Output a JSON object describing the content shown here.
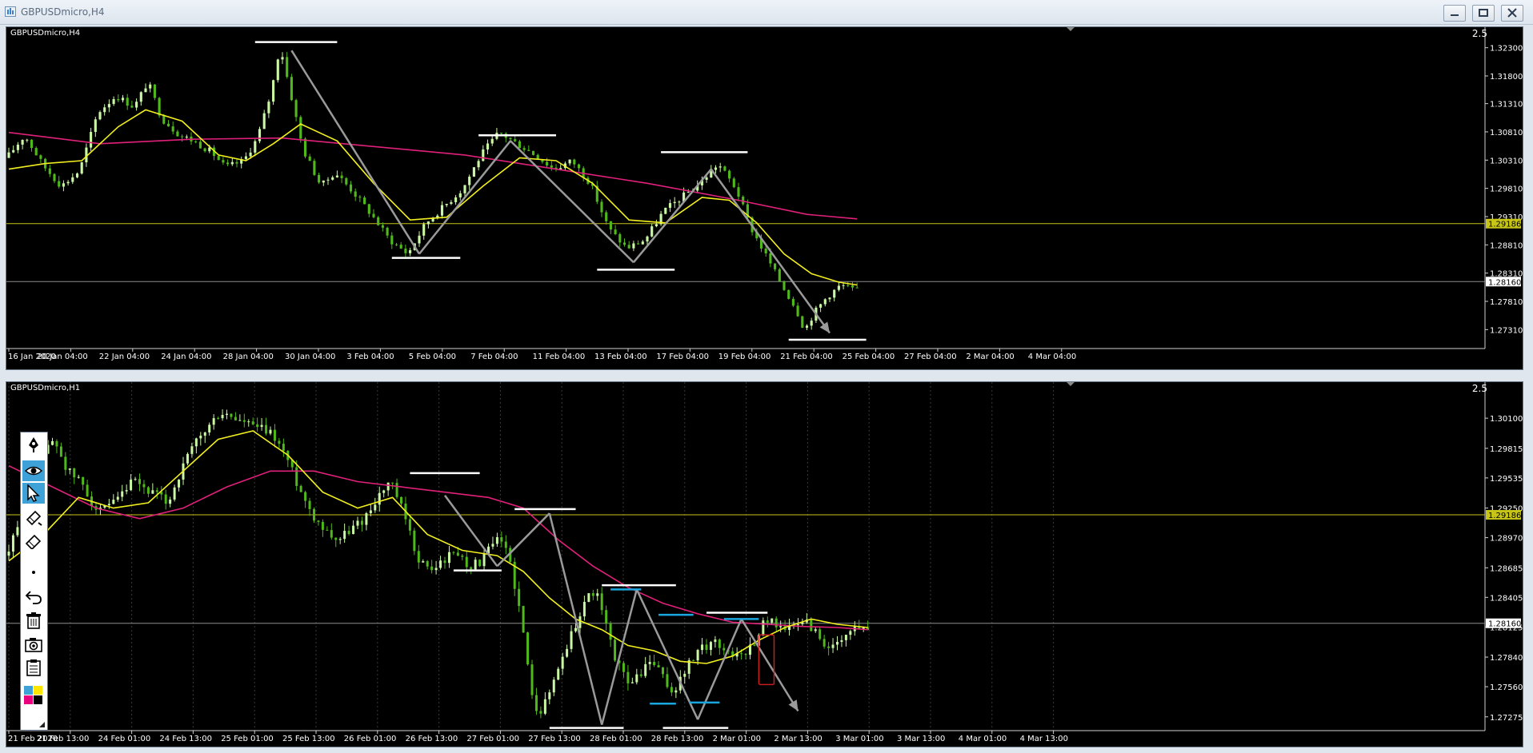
{
  "window": {
    "title": "GBPUSDmicro,H4"
  },
  "window_buttons": [
    "minimize",
    "restore",
    "close"
  ],
  "colors": {
    "background": "#000000",
    "bull_candle": "#caf7a4",
    "bear_candle": "#4fb81a",
    "ma_fast": "#f2ef1e",
    "ma_slow": "#e0207a",
    "horizontal_line": "#c7c418",
    "price_line": "#8e8e8e",
    "swing_line": "#9a9a9a",
    "level_white": "#ffffff",
    "level_cyan": "#19a7e0",
    "highlight_box": "#c81e1e"
  },
  "panes": [
    {
      "label": "GBPUSDmicro,H4",
      "scale_number": "2.5",
      "price_ticks": [
        "1.32300",
        "1.31800",
        "1.31310",
        "1.30810",
        "1.30310",
        "1.29810",
        "1.29310",
        "1.28810",
        "1.28310",
        "1.27810",
        "1.27310"
      ],
      "date_ticks": [
        "16 Jan 2020",
        "20 Jan 04:00",
        "22 Jan 04:00",
        "24 Jan 04:00",
        "28 Jan 04:00",
        "30 Jan 04:00",
        "3 Feb 04:00",
        "5 Feb 04:00",
        "7 Feb 04:00",
        "11 Feb 04:00",
        "13 Feb 04:00",
        "17 Feb 04:00",
        "19 Feb 04:00",
        "21 Feb 04:00",
        "25 Feb 04:00",
        "27 Feb 04:00",
        "2 Mar 04:00",
        "4 Mar 04:00"
      ],
      "hline_label": "1.29186",
      "price_label": "1.28160"
    },
    {
      "label": "GBPUSDmicro,H1",
      "scale_number": "2.5",
      "price_ticks": [
        "1.30100",
        "1.29815",
        "1.29535",
        "1.29250",
        "1.28970",
        "1.28685",
        "1.28405",
        "1.28125",
        "1.27840",
        "1.27560",
        "1.27275"
      ],
      "date_ticks": [
        "21 Feb 2020",
        "21 Feb 13:00",
        "24 Feb 01:00",
        "24 Feb 13:00",
        "25 Feb 01:00",
        "25 Feb 13:00",
        "26 Feb 01:00",
        "26 Feb 13:00",
        "27 Feb 01:00",
        "27 Feb 13:00",
        "28 Feb 01:00",
        "28 Feb 13:00",
        "2 Mar 01:00",
        "2 Mar 13:00",
        "3 Mar 01:00",
        "3 Mar 13:00",
        "4 Mar 01:00",
        "4 Mar 13:00"
      ],
      "hline_label": "1.29186",
      "price_label": "1.28160"
    }
  ],
  "drawing_toolbar": {
    "tools": [
      "pen-icon",
      "eye-icon",
      "cursor-icon",
      "pencil-icon",
      "eraser-icon",
      "dot-icon",
      "undo-icon",
      "trash-icon",
      "camera-icon",
      "clipboard-icon"
    ],
    "palette": [
      "#3ea2d8",
      "#ffe600",
      "#e8007e",
      "#000000"
    ]
  },
  "chart_data": [
    {
      "type": "candlestick",
      "title": "GBPUSDmicro,H4",
      "ylim": [
        1.2706,
        1.3255
      ],
      "horizontal_levels": [
        1.29186,
        1.2816
      ],
      "price_path": [
        [
          0,
          1.3035
        ],
        [
          4,
          1.3075
        ],
        [
          8,
          1.3022
        ],
        [
          12,
          1.2985
        ],
        [
          16,
          1.3012
        ],
        [
          20,
          1.3115
        ],
        [
          24,
          1.3145
        ],
        [
          28,
          1.3125
        ],
        [
          31,
          1.317
        ],
        [
          34,
          1.3105
        ],
        [
          38,
          1.3075
        ],
        [
          41,
          1.3065
        ],
        [
          45,
          1.3045
        ],
        [
          48,
          1.3018
        ],
        [
          52,
          1.303
        ],
        [
          55,
          1.307
        ],
        [
          58,
          1.315
        ],
        [
          60,
          1.3235
        ],
        [
          62,
          1.316
        ],
        [
          65,
          1.305
        ],
        [
          69,
          1.2985
        ],
        [
          72,
          1.301
        ],
        [
          76,
          1.2975
        ],
        [
          80,
          1.2935
        ],
        [
          84,
          1.289
        ],
        [
          88,
          1.2865
        ],
        [
          92,
          1.292
        ],
        [
          96,
          1.295
        ],
        [
          100,
          1.298
        ],
        [
          104,
          1.304
        ],
        [
          108,
          1.308
        ],
        [
          112,
          1.306
        ],
        [
          116,
          1.304
        ],
        [
          120,
          1.3015
        ],
        [
          124,
          1.303
        ],
        [
          128,
          1.299
        ],
        [
          132,
          1.291
        ],
        [
          136,
          1.2875
        ],
        [
          140,
          1.289
        ],
        [
          144,
          1.294
        ],
        [
          148,
          1.2965
        ],
        [
          152,
          1.299
        ],
        [
          156,
          1.3025
        ],
        [
          160,
          1.298
        ],
        [
          163,
          1.2915
        ],
        [
          166,
          1.287
        ],
        [
          170,
          1.281
        ],
        [
          173,
          1.277
        ],
        [
          175,
          1.273
        ],
        [
          177,
          1.276
        ],
        [
          180,
          1.279
        ],
        [
          183,
          1.281
        ],
        [
          186,
          1.28
        ]
      ],
      "ma_fast": [
        [
          0,
          1.3015
        ],
        [
          8,
          1.3025
        ],
        [
          16,
          1.303
        ],
        [
          24,
          1.309
        ],
        [
          30,
          1.312
        ],
        [
          38,
          1.31
        ],
        [
          46,
          1.304
        ],
        [
          52,
          1.303
        ],
        [
          58,
          1.306
        ],
        [
          64,
          1.3095
        ],
        [
          72,
          1.3065
        ],
        [
          80,
          1.299
        ],
        [
          88,
          1.2925
        ],
        [
          96,
          1.293
        ],
        [
          104,
          1.2985
        ],
        [
          112,
          1.3035
        ],
        [
          120,
          1.303
        ],
        [
          128,
          1.299
        ],
        [
          136,
          1.2925
        ],
        [
          144,
          1.292
        ],
        [
          152,
          1.2965
        ],
        [
          158,
          1.296
        ],
        [
          164,
          1.292
        ],
        [
          170,
          1.2865
        ],
        [
          176,
          1.283
        ],
        [
          182,
          1.2815
        ],
        [
          186,
          1.281
        ]
      ],
      "ma_slow": [
        [
          0,
          1.308
        ],
        [
          20,
          1.306
        ],
        [
          40,
          1.3068
        ],
        [
          60,
          1.307
        ],
        [
          80,
          1.3055
        ],
        [
          100,
          1.304
        ],
        [
          120,
          1.3015
        ],
        [
          140,
          1.299
        ],
        [
          160,
          1.296
        ],
        [
          175,
          1.2935
        ],
        [
          186,
          1.2927
        ]
      ],
      "swing_lines": [
        [
          [
            62,
            1.3225
          ],
          [
            90,
            1.2865
          ]
        ],
        [
          [
            90,
            1.2865
          ],
          [
            110,
            1.3065
          ]
        ],
        [
          [
            110,
            1.3065
          ],
          [
            137,
            1.285
          ]
        ],
        [
          [
            137,
            1.285
          ],
          [
            154,
            1.3015
          ]
        ],
        [
          [
            154,
            1.3015
          ],
          [
            180,
            1.2725
          ]
        ]
      ],
      "levels": [
        {
          "y": 1.324,
          "x1": 54,
          "x2": 72
        },
        {
          "y": 1.3075,
          "x1": 103,
          "x2": 120
        },
        {
          "y": 1.2858,
          "x1": 84,
          "x2": 99
        },
        {
          "y": 1.3045,
          "x1": 143,
          "x2": 162
        },
        {
          "y": 1.2837,
          "x1": 129,
          "x2": 146
        },
        {
          "y": 1.2713,
          "x1": 171,
          "x2": 188
        }
      ]
    },
    {
      "type": "candlestick",
      "title": "GBPUSDmicro,H1",
      "ylim": [
        1.2719,
        1.3026
      ],
      "horizontal_levels": [
        1.29186,
        1.2816
      ],
      "price_path": [
        [
          0,
          1.288
        ],
        [
          4,
          1.292
        ],
        [
          8,
          1.2975
        ],
        [
          11,
          1.299
        ],
        [
          14,
          1.296
        ],
        [
          17,
          1.295
        ],
        [
          21,
          1.292
        ],
        [
          25,
          1.293
        ],
        [
          29,
          1.295
        ],
        [
          33,
          1.294
        ],
        [
          37,
          1.293
        ],
        [
          40,
          1.296
        ],
        [
          43,
          1.2985
        ],
        [
          46,
          1.3
        ],
        [
          49,
          1.3015
        ],
        [
          52,
          1.301
        ],
        [
          55,
          1.3005
        ],
        [
          58,
          1.3
        ],
        [
          61,
          1.2995
        ],
        [
          64,
          1.2975
        ],
        [
          67,
          1.2945
        ],
        [
          70,
          1.292
        ],
        [
          73,
          1.2905
        ],
        [
          76,
          1.2895
        ],
        [
          79,
          1.2905
        ],
        [
          82,
          1.2915
        ],
        [
          85,
          1.2935
        ],
        [
          88,
          1.295
        ],
        [
          91,
          1.292
        ],
        [
          94,
          1.288
        ],
        [
          97,
          1.2865
        ],
        [
          100,
          1.2875
        ],
        [
          103,
          1.2885
        ],
        [
          106,
          1.287
        ],
        [
          109,
          1.2875
        ],
        [
          112,
          1.2895
        ],
        [
          115,
          1.2885
        ],
        [
          118,
          1.282
        ],
        [
          120,
          1.276
        ],
        [
          122,
          1.273
        ],
        [
          124,
          1.2745
        ],
        [
          127,
          1.278
        ],
        [
          130,
          1.281
        ],
        [
          133,
          1.284
        ],
        [
          135,
          1.2848
        ],
        [
          137,
          1.282
        ],
        [
          139,
          1.279
        ],
        [
          141,
          1.277
        ],
        [
          143,
          1.276
        ],
        [
          145,
          1.2765
        ],
        [
          147,
          1.278
        ],
        [
          149,
          1.2775
        ],
        [
          151,
          1.276
        ],
        [
          153,
          1.275
        ],
        [
          156,
          1.2775
        ],
        [
          159,
          1.279
        ],
        [
          162,
          1.28
        ],
        [
          165,
          1.279
        ],
        [
          168,
          1.2785
        ],
        [
          171,
          1.2795
        ],
        [
          174,
          1.282
        ],
        [
          177,
          1.2815
        ],
        [
          180,
          1.281
        ],
        [
          183,
          1.282
        ],
        [
          186,
          1.2805
        ],
        [
          189,
          1.279
        ],
        [
          192,
          1.28
        ],
        [
          195,
          1.2815
        ],
        [
          197,
          1.281
        ]
      ],
      "ma_fast": [
        [
          0,
          1.2875
        ],
        [
          8,
          1.29
        ],
        [
          16,
          1.2935
        ],
        [
          24,
          1.2925
        ],
        [
          32,
          1.293
        ],
        [
          40,
          1.296
        ],
        [
          48,
          1.299
        ],
        [
          56,
          1.2998
        ],
        [
          64,
          1.2975
        ],
        [
          72,
          1.294
        ],
        [
          80,
          1.2925
        ],
        [
          88,
          1.2935
        ],
        [
          96,
          1.29
        ],
        [
          104,
          1.2885
        ],
        [
          112,
          1.288
        ],
        [
          118,
          1.2865
        ],
        [
          124,
          1.284
        ],
        [
          130,
          1.282
        ],
        [
          136,
          1.281
        ],
        [
          142,
          1.2795
        ],
        [
          148,
          1.279
        ],
        [
          154,
          1.278
        ],
        [
          160,
          1.2778
        ],
        [
          166,
          1.2785
        ],
        [
          172,
          1.28
        ],
        [
          178,
          1.2812
        ],
        [
          184,
          1.282
        ],
        [
          190,
          1.2815
        ],
        [
          197,
          1.2812
        ]
      ],
      "ma_slow": [
        [
          0,
          1.2965
        ],
        [
          10,
          1.2945
        ],
        [
          20,
          1.2925
        ],
        [
          30,
          1.2915
        ],
        [
          40,
          1.2925
        ],
        [
          50,
          1.2945
        ],
        [
          60,
          1.296
        ],
        [
          70,
          1.296
        ],
        [
          80,
          1.295
        ],
        [
          90,
          1.2945
        ],
        [
          100,
          1.294
        ],
        [
          110,
          1.2935
        ],
        [
          118,
          1.2925
        ],
        [
          126,
          1.2895
        ],
        [
          134,
          1.287
        ],
        [
          142,
          1.285
        ],
        [
          150,
          1.2835
        ],
        [
          158,
          1.2825
        ],
        [
          166,
          1.2817
        ],
        [
          174,
          1.2815
        ],
        [
          182,
          1.2813
        ],
        [
          190,
          1.2812
        ],
        [
          197,
          1.281
        ]
      ],
      "swing_lines": [
        [
          [
            100,
            1.2937
          ],
          [
            112,
            1.287
          ]
        ],
        [
          [
            112,
            1.287
          ],
          [
            124,
            1.292
          ]
        ],
        [
          [
            124,
            1.292
          ],
          [
            136,
            1.272
          ]
        ],
        [
          [
            136,
            1.272
          ],
          [
            144,
            1.2848
          ]
        ],
        [
          [
            144,
            1.2848
          ],
          [
            158,
            1.2725
          ]
        ],
        [
          [
            158,
            1.2725
          ],
          [
            168,
            1.282
          ]
        ],
        [
          [
            168,
            1.282
          ],
          [
            181,
            1.2733
          ]
        ]
      ],
      "levels": [
        {
          "y": 1.2958,
          "x1": 92,
          "x2": 108,
          "color": "white"
        },
        {
          "y": 1.2924,
          "x1": 116,
          "x2": 130,
          "color": "white"
        },
        {
          "y": 1.2866,
          "x1": 102,
          "x2": 113,
          "color": "white"
        },
        {
          "y": 1.2852,
          "x1": 136,
          "x2": 153,
          "color": "white"
        },
        {
          "y": 1.2717,
          "x1": 124,
          "x2": 141,
          "color": "white"
        },
        {
          "y": 1.2826,
          "x1": 160,
          "x2": 174,
          "color": "white"
        },
        {
          "y": 1.2717,
          "x1": 150,
          "x2": 165,
          "color": "white"
        },
        {
          "y": 1.2848,
          "x1": 138,
          "x2": 145,
          "color": "cyan"
        },
        {
          "y": 1.2824,
          "x1": 149,
          "x2": 157,
          "color": "cyan"
        },
        {
          "y": 1.274,
          "x1": 147,
          "x2": 153,
          "color": "cyan"
        },
        {
          "y": 1.2741,
          "x1": 156,
          "x2": 163,
          "color": "cyan"
        },
        {
          "y": 1.282,
          "x1": 164,
          "x2": 172,
          "color": "cyan"
        }
      ],
      "highlight_box": {
        "x1": 172,
        "x2": 175.5,
        "y_top": 1.2805,
        "y_bottom": 1.2758
      }
    }
  ]
}
